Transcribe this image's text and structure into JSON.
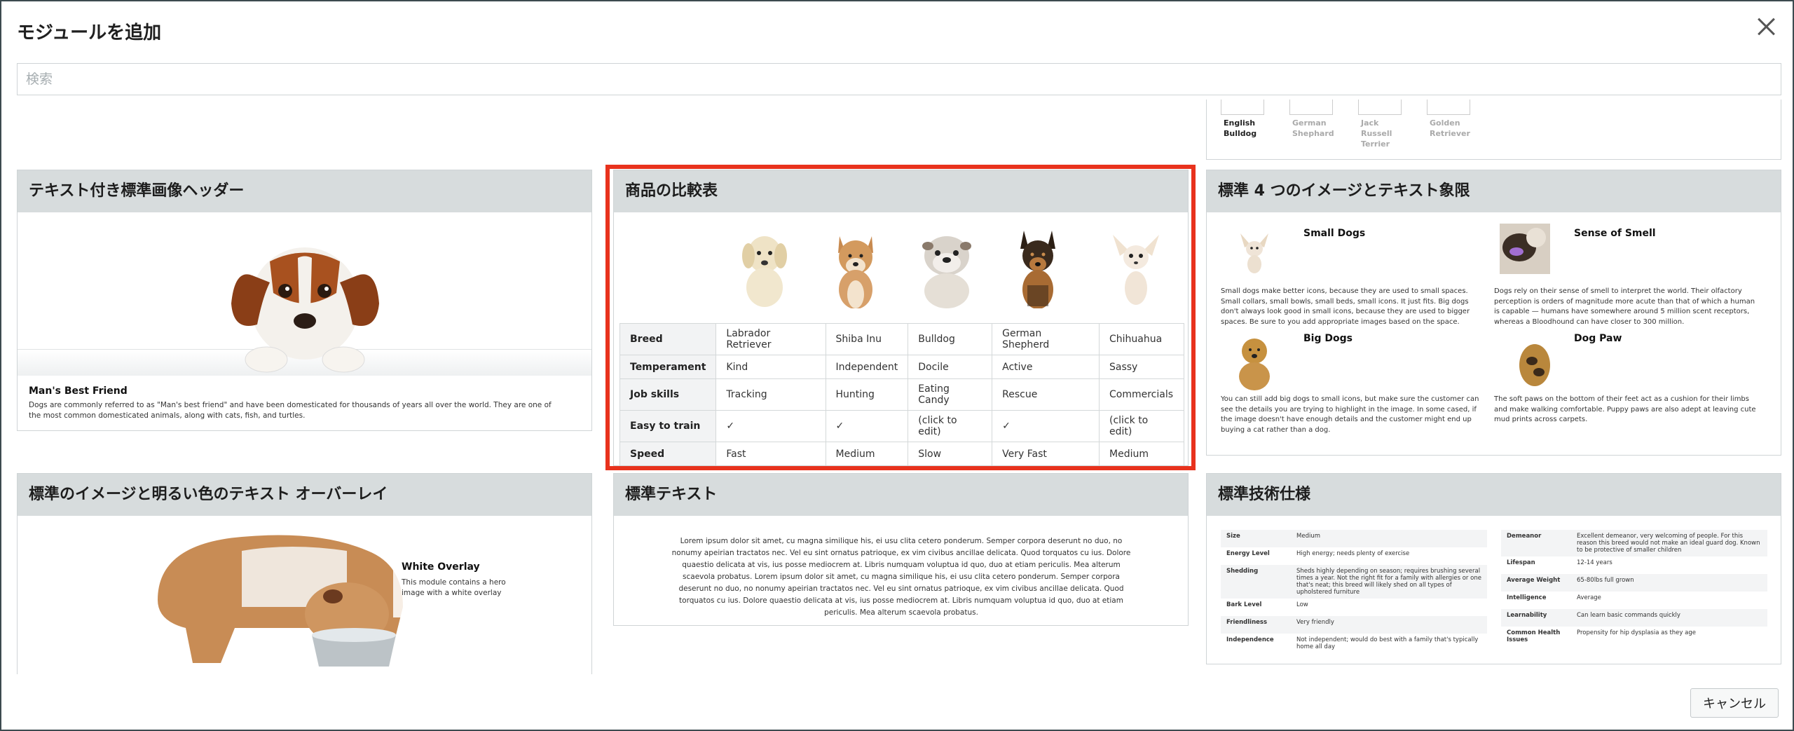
{
  "dialog": {
    "title": "モジュールを追加",
    "search_placeholder": "検索",
    "cancel_label": "キャンセル"
  },
  "partial_card": {
    "labels": [
      "English Bulldog",
      "German Shephard",
      "Jack Russell Terrier",
      "Golden Retriever"
    ]
  },
  "cards": {
    "header_image": {
      "title": "テキスト付き標準画像ヘッダー",
      "caption_title": "Man's Best Friend",
      "caption_text": "Dogs are commonly referred to as \"Man's best friend\" and have been domesticated for thousands of years all over the world. They are one of the most common domesticated animals, along with cats, fish, and turtles."
    },
    "comparison": {
      "title": "商品の比較表",
      "rows": [
        {
          "label": "Breed",
          "cells": [
            "Labrador Retriever",
            "Shiba Inu",
            "Bulldog",
            "German Shepherd",
            "Chihuahua"
          ]
        },
        {
          "label": "Temperament",
          "cells": [
            "Kind",
            "Independent",
            "Docile",
            "Active",
            "Sassy"
          ]
        },
        {
          "label": "Job skills",
          "cells": [
            "Tracking",
            "Hunting",
            "Eating Candy",
            "Rescue",
            "Commercials"
          ]
        },
        {
          "label": "Easy to train",
          "cells": [
            "✓",
            "✓",
            "(click to edit)",
            "✓",
            "(click to edit)"
          ]
        },
        {
          "label": "Speed",
          "cells": [
            "Fast",
            "Medium",
            "Slow",
            "Very Fast",
            "Medium"
          ]
        }
      ]
    },
    "four_images": {
      "title": "標準 4 つのイメージとテキスト象限",
      "items": [
        {
          "heading": "Small Dogs",
          "text": "Small dogs make better icons, because they are used to small spaces. Small collars, small bowls, small beds, small icons. It just fits. Big dogs don't always look good in small icons, because they are used to bigger spaces. Be sure to you add appropriate images based on the space."
        },
        {
          "heading": "Sense of Smell",
          "text": "Dogs rely on their sense of smell to interpret the world. Their olfactory perception is orders of magnitude more acute than that of which a human is capable — humans have somewhere around 5 million scent receptors, whereas a Bloodhound can have closer to 300 million."
        },
        {
          "heading": "Big Dogs",
          "text": "You can still add big dogs to small icons, but make sure the customer can see the details you are trying to highlight in the image. In some cased, if the image doesn't have enough details and the customer might end up buying a cat rather than a dog."
        },
        {
          "heading": "Dog Paw",
          "text": "The soft paws on the bottom of their feet act as a cushion for their limbs and make walking comfortable. Puppy paws are also adept at leaving cute mud prints across carpets."
        }
      ]
    },
    "overlay": {
      "title": "標準のイメージと明るい色のテキスト オーバーレイ",
      "overlay_title": "White Overlay",
      "overlay_text": "This module contains a hero image with a white overlay"
    },
    "standard_text": {
      "title": "標準テキスト",
      "body": "Lorem ipsum dolor sit amet, cu magna similique his, ei usu clita cetero ponderum. Semper corpora deserunt no duo, no nonumy apeirian tractatos nec. Vel eu sint ornatus patrioque, ex vim civibus ancillae delicata. Quod torquatos cu ius. Dolore quaestio delicata at vis, ius posse mediocrem at. Libris numquam voluptua id quo, duo at etiam periculis. Mea alterum scaevola probatus. Lorem ipsum dolor sit amet, cu magna similique his, ei usu clita cetero ponderum. Semper corpora deserunt no duo, no nonumy apeirian tractatos nec. Vel eu sint ornatus patrioque, ex vim civibus ancillae delicata. Quod torquatos cu ius. Dolore quaestio delicata at vis, ius posse mediocrem at. Libris numquam voluptua id quo, duo at etiam periculis. Mea alterum scaevola probatus."
    },
    "tech_spec": {
      "title": "標準技術仕様",
      "left": [
        {
          "k": "Size",
          "v": "Medium"
        },
        {
          "k": "Energy Level",
          "v": "High energy; needs plenty of exercise"
        },
        {
          "k": "Shedding",
          "v": "Sheds highly depending on season; requires brushing several times a year. Not the right fit for a family with allergies or one that's neat; this breed will likely shed on all types of upholstered furniture"
        },
        {
          "k": "Bark Level",
          "v": "Low"
        },
        {
          "k": "Friendliness",
          "v": "Very friendly"
        },
        {
          "k": "Independence",
          "v": "Not independent; would do best with a family that's typically home all day"
        }
      ],
      "right": [
        {
          "k": "Demeanor",
          "v": "Excellent demeanor, very welcoming of people. For this reason this breed would not make an ideal guard dog. Known to be protective of smaller children"
        },
        {
          "k": "Lifespan",
          "v": "12-14 years"
        },
        {
          "k": "Average Weight",
          "v": "65-80lbs full grown"
        },
        {
          "k": "Intelligence",
          "v": "Average"
        },
        {
          "k": "Learnability",
          "v": "Can learn basic commands quickly"
        },
        {
          "k": "Common Health Issues",
          "v": "Propensity for hip dysplasia as they age"
        }
      ]
    }
  }
}
